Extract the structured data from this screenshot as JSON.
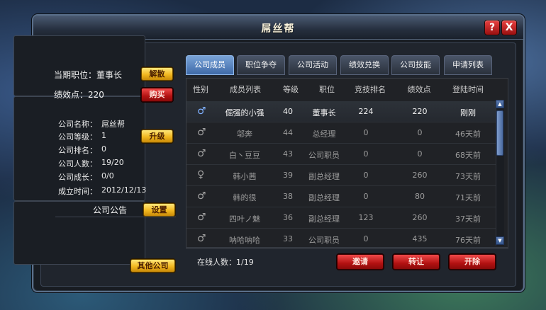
{
  "window": {
    "title": "屌丝帮",
    "help_label": "?",
    "close_label": "X"
  },
  "status": {
    "position_label": "当期职位：董事长",
    "disband_label": "解散",
    "points_label": "绩效点：220",
    "buy_label": "购买"
  },
  "company": {
    "name_label": "公司名称：",
    "name_value": "屌丝帮",
    "level_label": "公司等级：",
    "level_value": "1",
    "upgrade_label": "升级",
    "rank_label": "公司排名：",
    "rank_value": "0",
    "members_label": "公司人数：",
    "members_value": "19/20",
    "growth_label": "公司成长：",
    "growth_value": "0/0",
    "founded_label": "成立时间：",
    "founded_value": "2012/12/13"
  },
  "notice": {
    "title": "公司公告",
    "settings_label": "设置"
  },
  "other_company_label": "其他公司",
  "tabs": [
    "公司成员",
    "职位争夺",
    "公司活动",
    "绩效兑换",
    "公司技能",
    "申请列表"
  ],
  "table": {
    "headers": [
      "性别",
      "成员列表",
      "等级",
      "职位",
      "竞技排名",
      "绩效点",
      "登陆时间"
    ],
    "rows": [
      {
        "gender": "♂",
        "name": "倔强的小强",
        "level": "40",
        "position": "董事长",
        "arena": "224",
        "points": "220",
        "login": "刚刚"
      },
      {
        "gender": "♂",
        "name": "邬奔",
        "level": "44",
        "position": "总经理",
        "arena": "0",
        "points": "0",
        "login": "46天前"
      },
      {
        "gender": "♂",
        "name": "白丶豆豆",
        "level": "43",
        "position": "公司职员",
        "arena": "0",
        "points": "0",
        "login": "68天前"
      },
      {
        "gender": "♀",
        "name": "韩小茜",
        "level": "39",
        "position": "副总经理",
        "arena": "0",
        "points": "260",
        "login": "73天前"
      },
      {
        "gender": "♂",
        "name": "韩的很",
        "level": "38",
        "position": "副总经理",
        "arena": "0",
        "points": "80",
        "login": "71天前"
      },
      {
        "gender": "♂",
        "name": "四叶ノ魅",
        "level": "36",
        "position": "副总经理",
        "arena": "123",
        "points": "260",
        "login": "37天前"
      },
      {
        "gender": "♂",
        "name": "呐哈呐哈",
        "level": "33",
        "position": "公司职员",
        "arena": "0",
        "points": "435",
        "login": "76天前"
      }
    ]
  },
  "footer": {
    "online_label": "在线人数：1/19",
    "invite_label": "邀请",
    "transfer_label": "转让",
    "remove_label": "开除"
  },
  "colors": {
    "accent": "#3f6aa8",
    "gold_button": "#f2b820",
    "red_button": "#b31212"
  }
}
